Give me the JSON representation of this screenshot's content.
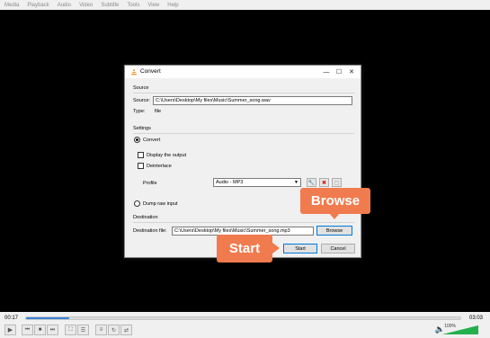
{
  "menu": [
    "Media",
    "Playback",
    "Audio",
    "Video",
    "Subtitle",
    "Tools",
    "View",
    "Help"
  ],
  "dialog": {
    "title": "Convert",
    "source_group": "Source",
    "source_label": "Source:",
    "source_value": "C:\\Users\\Desktop\\My files\\Music\\Summer_song.wav",
    "type_label": "Type:",
    "type_value": "file",
    "settings_group": "Settings",
    "convert_label": "Convert",
    "display_output_label": "Display the output",
    "deinterlace_label": "Deinterlace",
    "profile_label": "Profile",
    "profile_value": "Audio - MP3",
    "dump_raw_label": "Dump raw input",
    "destination_group": "Destination",
    "dest_file_label": "Destination file:",
    "dest_file_value": "C:\\Users\\Desktop\\My files\\Music\\Summer_song.mp3",
    "browse_label": "Browse",
    "start_label": "Start",
    "cancel_label": "Cancel"
  },
  "callouts": {
    "browse": "Browse",
    "start": "Start"
  },
  "player": {
    "time_current": "00:17",
    "time_total": "03:03",
    "progress": 0.1,
    "volume_label": "100%",
    "volume": 1.0
  },
  "colors": {
    "accent": "#3a83d7",
    "callout": "#f07b4f",
    "vlc_orange": "#f08c1e",
    "volume_green": "#22b14c"
  }
}
